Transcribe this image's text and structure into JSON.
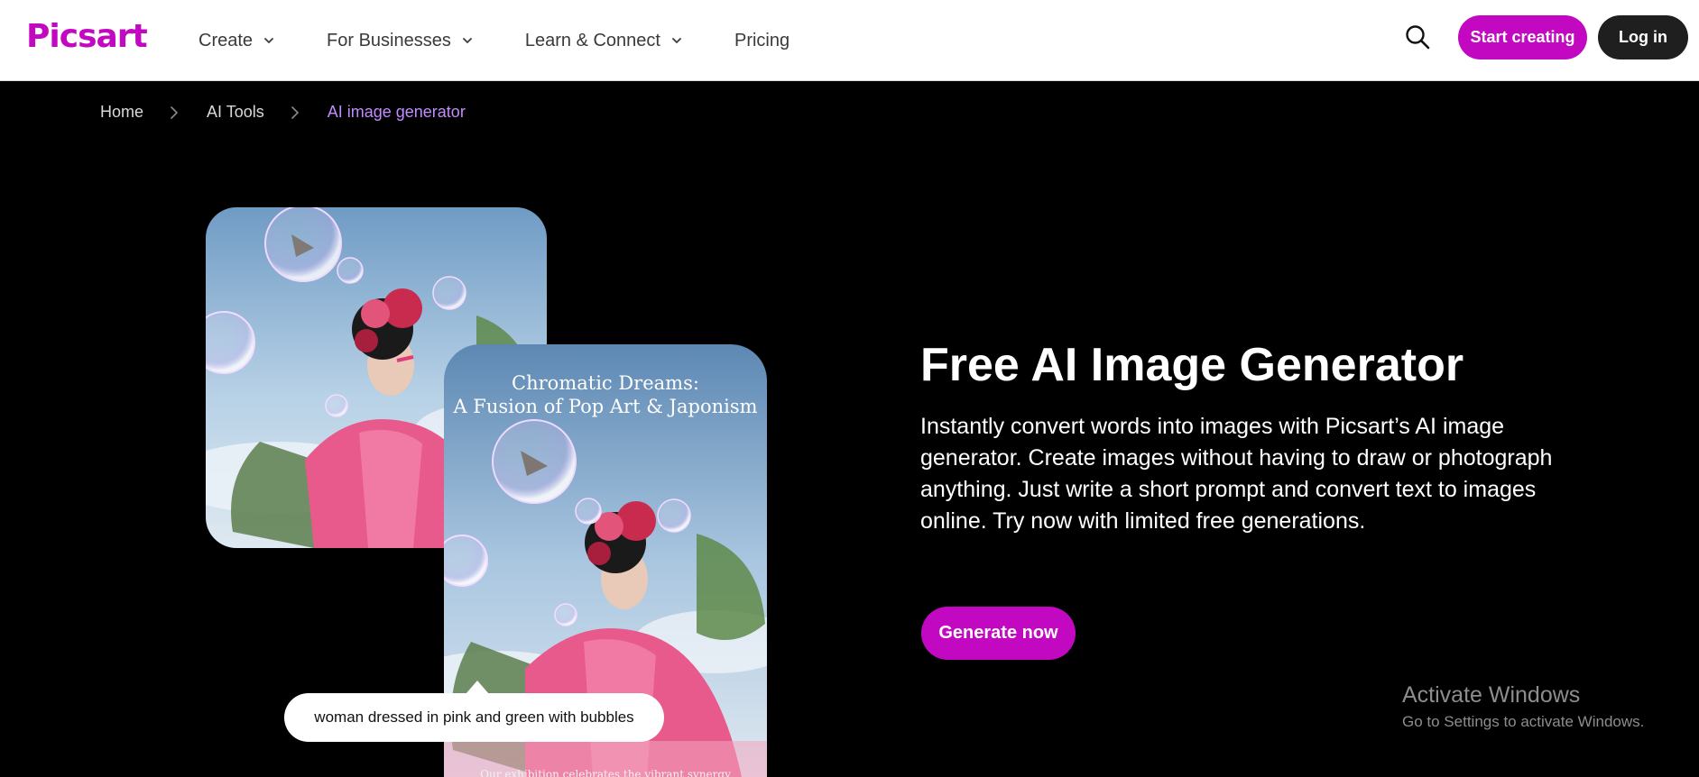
{
  "header": {
    "logo": "Picsart",
    "nav": [
      {
        "label": "Create",
        "has_dropdown": true
      },
      {
        "label": "For Businesses",
        "has_dropdown": true
      },
      {
        "label": "Learn & Connect",
        "has_dropdown": true
      },
      {
        "label": "Pricing",
        "has_dropdown": false
      }
    ],
    "search_icon": "search-icon",
    "start_creating": "Start creating",
    "log_in": "Log in"
  },
  "breadcrumb": {
    "home": "Home",
    "ai_tools": "AI Tools",
    "current": "AI image generator"
  },
  "showcase": {
    "poster_title_line1": "Chromatic Dreams:",
    "poster_title_line2": "A Fusion of Pop Art & Japonism",
    "poster_footer": "Our exhibition celebrates the vibrant synergy",
    "prompt": "woman dressed in pink and green with bubbles"
  },
  "hero": {
    "title": "Free AI Image Generator",
    "description": "Instantly convert words into images with Picsart’s AI image generator. Create images without having to draw or photograph anything. Just write a short prompt and convert text to images online. Try now with limited free generations.",
    "cta": "Generate now"
  },
  "watermark": {
    "title": "Activate Windows",
    "subtitle": "Go to Settings to activate Windows."
  },
  "colors": {
    "brand": "#c209c1",
    "breadcrumb_current": "#c28bff",
    "background": "#000000",
    "header_bg": "#ffffff"
  }
}
